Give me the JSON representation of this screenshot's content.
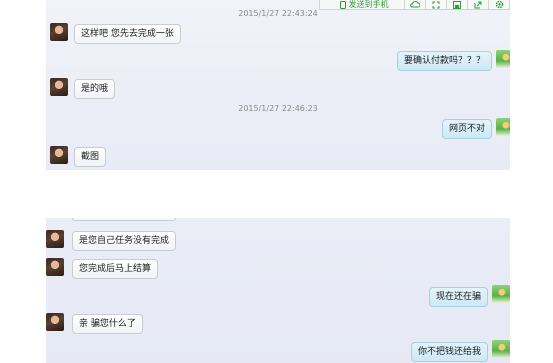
{
  "toolbar": {
    "send_to_phone_label": "发送到手机",
    "icons": [
      "cloud-icon",
      "fullscreen-icon",
      "save-icon",
      "share-icon",
      "settings-icon"
    ]
  },
  "colors": {
    "accent": "#2e9b3e",
    "bubble_out": "#d6eef7",
    "bubble_in": "#f4f5f7"
  },
  "chat_top": {
    "timestamp_1": "2015/1/27 22:43:24",
    "msg_1": "这样吧 您先去完成一张",
    "msg_2": "要确认付款吗？？？",
    "msg_3": "是的哦",
    "timestamp_2": "2015/1/27 22:46:23",
    "msg_4": "网页不对",
    "msg_5": "截图"
  },
  "chat_bottom": {
    "msg_1": "是您自己任务没有完成",
    "msg_2": "您完成后马上结算",
    "msg_3": "现在还在骗",
    "msg_4": "亲 骗您什么了",
    "msg_5": "你不把钱还给我"
  }
}
